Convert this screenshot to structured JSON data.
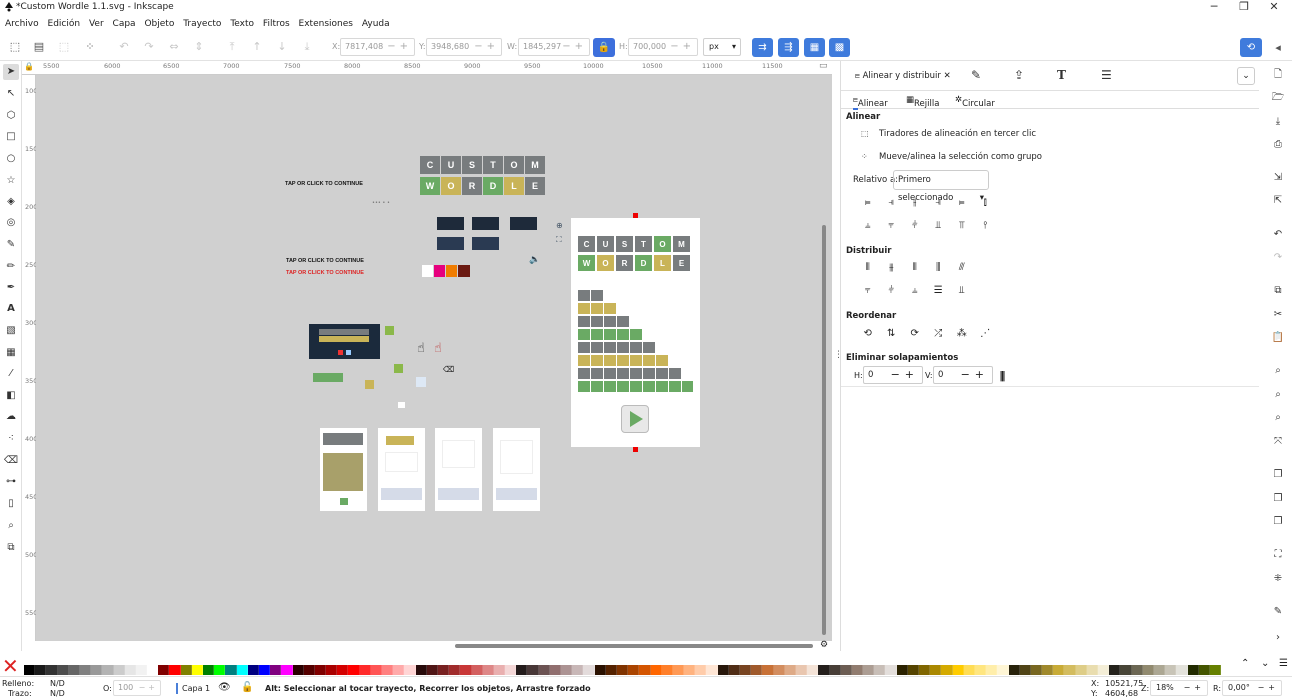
{
  "window": {
    "title": "*Custom Wordle 1.1.svg - Inkscape",
    "min": "─",
    "max": "❐",
    "close": "✕"
  },
  "menu": [
    "Archivo",
    "Edición",
    "Ver",
    "Capa",
    "Objeto",
    "Trayecto",
    "Texto",
    "Filtros",
    "Extensiones",
    "Ayuda"
  ],
  "toolbar": {
    "x_label": "X:",
    "x_value": "7817,408",
    "y_label": "Y:",
    "y_value": "3948,680",
    "w_label": "W:",
    "w_value": "1845,297",
    "h_label": "H:",
    "h_value": "700,000",
    "unit": "px"
  },
  "ruler": {
    "h_ticks": [
      "5500",
      "6000",
      "6500",
      "7000",
      "7500",
      "8000",
      "8500",
      "9000",
      "9500",
      "10000",
      "10500",
      "11000",
      "11500"
    ],
    "v_ticks": [
      "1000",
      "1500",
      "2000",
      "2500",
      "3000",
      "3500",
      "4000",
      "4500",
      "5000",
      "5500"
    ]
  },
  "canvas": {
    "letters_row1": [
      "C",
      "U",
      "S",
      "T",
      "O",
      "M"
    ],
    "letters_row2": [
      "W",
      "O",
      "R",
      "D",
      "L",
      "E"
    ],
    "tap_text": "TAP OR CLICK TO CONTINUE",
    "small_label": "••• • •"
  },
  "dock": {
    "tab_title": "Alinear y distribuir",
    "subtabs": [
      "Alinear",
      "Rejilla",
      "Circular"
    ],
    "sections": {
      "align": "Alinear",
      "distribute": "Distribuir",
      "reorder": "Reordenar",
      "overlap": "Eliminar solapamientos"
    },
    "option_handles": "Tiradores de alineación en tercer clic",
    "option_group": "Mueve/alinea la selección como grupo",
    "relative_label": "Relativo a:",
    "relative_value": "Primero seleccionado",
    "h_label": "H:",
    "h_value": "0",
    "v_label": "V:",
    "v_value": "0"
  },
  "palette": {
    "colors": [
      "#000000",
      "#1a1a1a",
      "#333333",
      "#4d4d4d",
      "#666666",
      "#808080",
      "#999999",
      "#b3b3b3",
      "#cccccc",
      "#e6e6e6",
      "#f2f2f2",
      "#ffffff",
      "#800000",
      "#ff0000",
      "#808000",
      "#ffff00",
      "#008000",
      "#00ff00",
      "#008080",
      "#00ffff",
      "#000080",
      "#0000ff",
      "#800080",
      "#ff00ff",
      "#2b0000",
      "#550000",
      "#800000",
      "#aa0000",
      "#d40000",
      "#ff0000",
      "#ff2a2a",
      "#ff5555",
      "#ff8080",
      "#ffaaaa",
      "#ffd5d5",
      "#280b0b",
      "#501616",
      "#782121",
      "#a02c2c",
      "#c83737",
      "#d35f5f",
      "#de8787",
      "#e9afaf",
      "#f4d7d7",
      "#241c1c",
      "#483737",
      "#6c5353",
      "#916f6f",
      "#ac9393",
      "#c8b7b7",
      "#e3dbdb",
      "#2b1100",
      "#552200",
      "#803300",
      "#aa4400",
      "#d45500",
      "#ff6600",
      "#ff7f2a",
      "#ff9955",
      "#ffb380",
      "#ffccaa",
      "#ffe6d5",
      "#28170b",
      "#502d16",
      "#784421",
      "#a05a2c",
      "#c87137",
      "#d38d5f",
      "#deaa87",
      "#e9c6af",
      "#f4e3d7",
      "#241f1c",
      "#483e37",
      "#6c5d53",
      "#917c6f",
      "#ac9d93",
      "#c8beb7",
      "#e3dedb",
      "#2b2200",
      "#554400",
      "#806600",
      "#aa8800",
      "#d4aa00",
      "#ffcc00",
      "#ffdd55",
      "#ffe680",
      "#ffeeaa",
      "#fff6d5",
      "#28220b",
      "#504416",
      "#786721",
      "#a0892c",
      "#c8ab37",
      "#d3bc5f",
      "#decd87",
      "#e9ddaf",
      "#f4eed7",
      "#24221c",
      "#484537",
      "#6c6753",
      "#918a6f",
      "#aca793",
      "#c8c4b7",
      "#e3e2db",
      "#222b00",
      "#445500",
      "#668000"
    ]
  },
  "status": {
    "fill_label": "Relleno:",
    "fill_value": "N/D",
    "stroke_label": "Trazo:",
    "stroke_value": "N/D",
    "opacity_label": "O:",
    "opacity_value": "100",
    "layer": "Capa 1",
    "message": "Alt: Seleccionar al tocar trayecto, Recorrer los objetos, Arrastre forzado",
    "x_label": "X:",
    "x_value": "10521,75",
    "y_label": "Y:",
    "y_value": "4604,68",
    "z_label": "Z:",
    "zoom": "18%",
    "r_label": "R:",
    "rotation": "0,00°"
  }
}
